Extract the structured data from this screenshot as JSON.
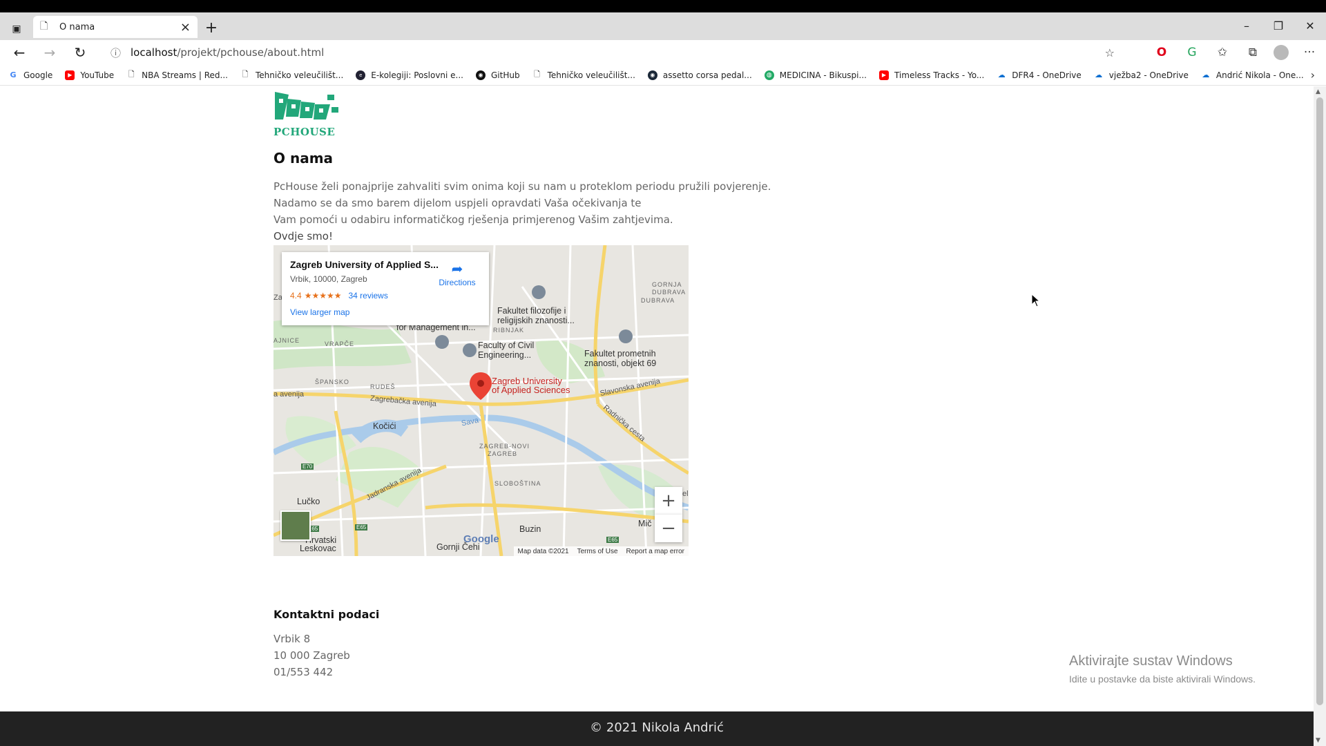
{
  "browser": {
    "tab_title": "O nama",
    "url_host": "localhost",
    "url_path": "/projekt/pchouse/about.html",
    "favorites": [
      {
        "label": "Google",
        "icon": "google-icon"
      },
      {
        "label": "YouTube",
        "icon": "youtube-icon"
      },
      {
        "label": "NBA Streams | Red...",
        "icon": "page-icon"
      },
      {
        "label": "Tehničko veleučilišt...",
        "icon": "page-icon"
      },
      {
        "label": "E-kolegiji: Poslovni e...",
        "icon": "ekolegiji-icon"
      },
      {
        "label": "GitHub",
        "icon": "github-icon"
      },
      {
        "label": "Tehničko veleučilišt...",
        "icon": "page-icon"
      },
      {
        "label": "assetto corsa pedal...",
        "icon": "steam-icon"
      },
      {
        "label": "MEDICINA - Bikuspi...",
        "icon": "globe-icon"
      },
      {
        "label": "Timeless Tracks - Yo...",
        "icon": "youtube-icon"
      },
      {
        "label": "DFR4 - OneDrive",
        "icon": "onedrive-icon"
      },
      {
        "label": "vježba2 - OneDrive",
        "icon": "onedrive-icon"
      },
      {
        "label": "Andrić Nikola - One...",
        "icon": "onedrive-icon"
      }
    ]
  },
  "page": {
    "logo_text": "PCHOUSE",
    "heading": "O nama",
    "paragraph_lines": [
      "PcHouse želi ponajprije zahvaliti svim onima koji su nam u proteklom periodu pružili povjerenje.",
      "Nadamo se da smo barem dijelom uspjeli opravdati Vaša očekivanja te",
      "Vam pomoći u odabiru informatičkog rješenja primjerenog Vašim zahtjevima."
    ],
    "here_text": "Ovdje smo!",
    "contact_title": "Kontaktni podaci",
    "contact_lines": [
      "Vrbik 8",
      "10 000 Zagreb",
      "01/553 442"
    ],
    "footer_text": "© 2021 Nikola Andrić"
  },
  "map": {
    "place_name": "Zagreb University of Applied S...",
    "place_address": "Vrbik, 10000, Zagreb",
    "rating": "4.4",
    "stars": "★★★★★",
    "reviews": "34 reviews",
    "directions": "Directions",
    "view_larger": "View larger map",
    "labels": {
      "za": "Za",
      "for_management": "for Management in...",
      "filozofije": "Fakultet filozofije i",
      "filozofije2": "religijskih znanosti...",
      "civil": "Faculty of Civil",
      "civil2": "Engineering...",
      "prometnih": "Fakultet prometnih",
      "prometnih2": "znanosti, objekt 69",
      "marker1": "Zagreb University",
      "marker2": "of Applied Sciences",
      "gornja_dubrava": "GORNJA",
      "gornja_dubrava2": "DUBRAVA",
      "dubrava": "DUBRAVA",
      "ribnjak": "RIBNJAK",
      "rudes": "RUDEŠ",
      "spansko": "ŠPANSKO",
      "vrapce": "VRAPČE",
      "ajnice": "AJNICE",
      "zagrebacka": "Zagrebačka avenija",
      "avenija": "a avenija",
      "slavonska": "Slavonska avenija",
      "radnicka": "Radnička cesta",
      "sava": "Sava",
      "kocici": "Kočići",
      "zagreb_novi": "ZAGREB-NOVI",
      "zagreb_novi2": "ZAGREB",
      "sloboština": "SLOBOŠTINA",
      "jadranska": "Jadranska avenija",
      "lucko": "Lučko",
      "buzin": "Buzin",
      "mic": "Mič",
      "hrvatski": "Hrvatski",
      "leskovac": "Leskovac",
      "gornji_cehi": "Gornji Čehi",
      "e70": "E70",
      "e65": "E65",
      "e65b": "E65",
      "e65c": "E65",
      "el": "el"
    },
    "google_text": "Google",
    "footer_items": [
      "Map data ©2021",
      "Terms of Use",
      "Report a map error"
    ],
    "zoom_in": "+",
    "zoom_out": "−"
  },
  "watermark": {
    "title": "Aktivirajte sustav Windows",
    "subtitle": "Idite u postavke da biste aktivirali Windows."
  }
}
